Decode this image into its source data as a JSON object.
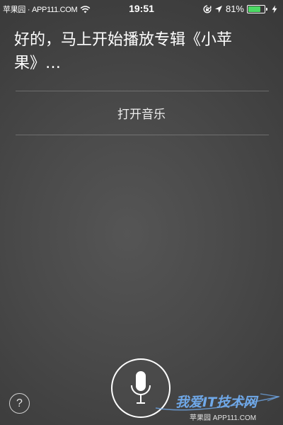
{
  "status_bar": {
    "carrier": "苹果园 · APP111.COM",
    "time": "19:51",
    "battery_percent": "81%",
    "battery_level": 0.81,
    "icons": [
      "wifi-icon",
      "rotation-lock-icon",
      "location-icon",
      "battery-icon",
      "charging-icon"
    ]
  },
  "siri": {
    "response_text": "好的，马上开始播放专辑《小苹果》…",
    "action_label": "打开音乐"
  },
  "controls": {
    "mic_icon": "microphone-icon",
    "help_label": "?"
  },
  "watermark": {
    "logo_text": "我爱IT技术网",
    "sub_text": "苹果园 APP111.COM"
  },
  "colors": {
    "background": "#4a4a4a",
    "text": "#ffffff",
    "battery_fill": "#4cd964",
    "watermark_blue": "#6fa8e8"
  }
}
